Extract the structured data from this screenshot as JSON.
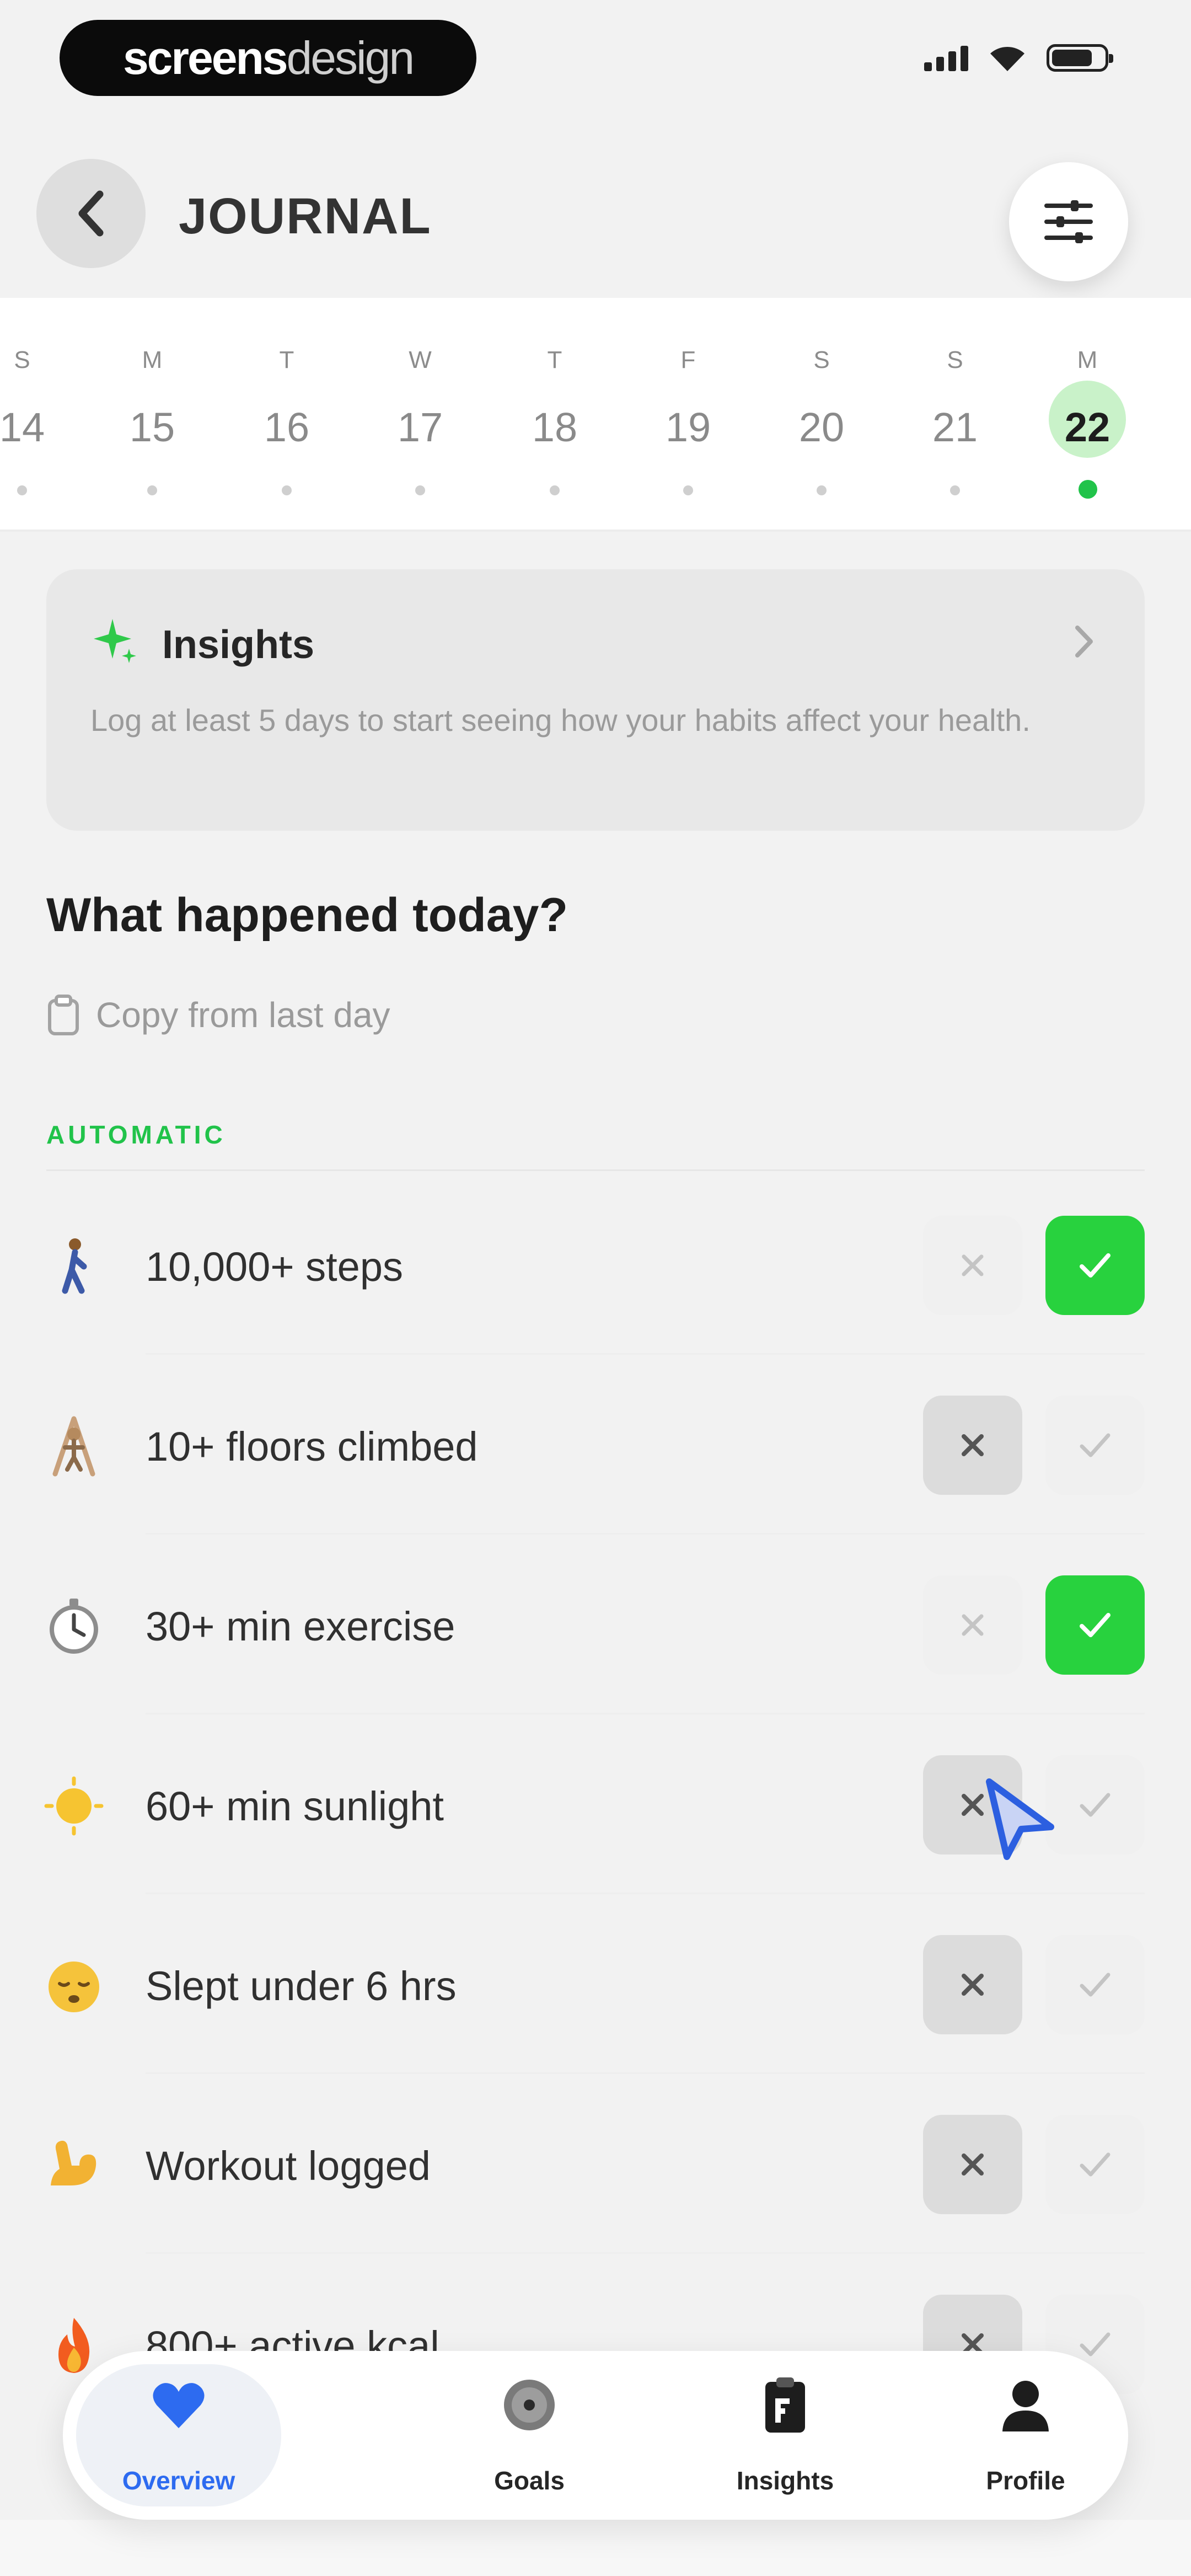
{
  "status_bar": {
    "brand_bold": "screens",
    "brand_light": "design"
  },
  "header": {
    "title": "JOURNAL"
  },
  "date_strip": {
    "days": [
      {
        "weekday": "S",
        "day": "14"
      },
      {
        "weekday": "M",
        "day": "15"
      },
      {
        "weekday": "T",
        "day": "16"
      },
      {
        "weekday": "W",
        "day": "17"
      },
      {
        "weekday": "T",
        "day": "18"
      },
      {
        "weekday": "F",
        "day": "19"
      },
      {
        "weekday": "S",
        "day": "20"
      },
      {
        "weekday": "S",
        "day": "21"
      },
      {
        "weekday": "M",
        "day": "22"
      }
    ],
    "selected_day": "22"
  },
  "insights": {
    "title": "Insights",
    "text": "Log at least 5 days to start seeing how your habits affect your health."
  },
  "question": "What happened today?",
  "copy_label": "Copy from last day",
  "section_label": "AUTOMATIC",
  "habits": [
    {
      "label": "10,000+ steps",
      "icon": "person-walking-icon",
      "answer": "yes"
    },
    {
      "label": "10+ floors climbed",
      "icon": "person-climbing-icon",
      "answer": "no"
    },
    {
      "label": "30+ min exercise",
      "icon": "stopwatch-icon",
      "answer": "yes"
    },
    {
      "label": "60+ min sunlight",
      "icon": "sun-icon",
      "answer": "no"
    },
    {
      "label": "Slept under 6 hrs",
      "icon": "sleeping-face-icon",
      "answer": "no"
    },
    {
      "label": "Workout logged",
      "icon": "flexed-biceps-icon",
      "answer": "no"
    },
    {
      "label": "800+ active kcal",
      "icon": "fire-icon",
      "answer": "no"
    }
  ],
  "tabbar": {
    "tabs": [
      {
        "label": "Overview",
        "icon": "heart-icon"
      },
      {
        "label": "Goals",
        "icon": "target-icon"
      },
      {
        "label": "Insights",
        "icon": "clipboard-icon"
      },
      {
        "label": "Profile",
        "icon": "person-icon"
      }
    ],
    "active": "Overview"
  },
  "colors": {
    "accent_green": "#28d23e",
    "tab_active_blue": "#2d6bf0"
  }
}
